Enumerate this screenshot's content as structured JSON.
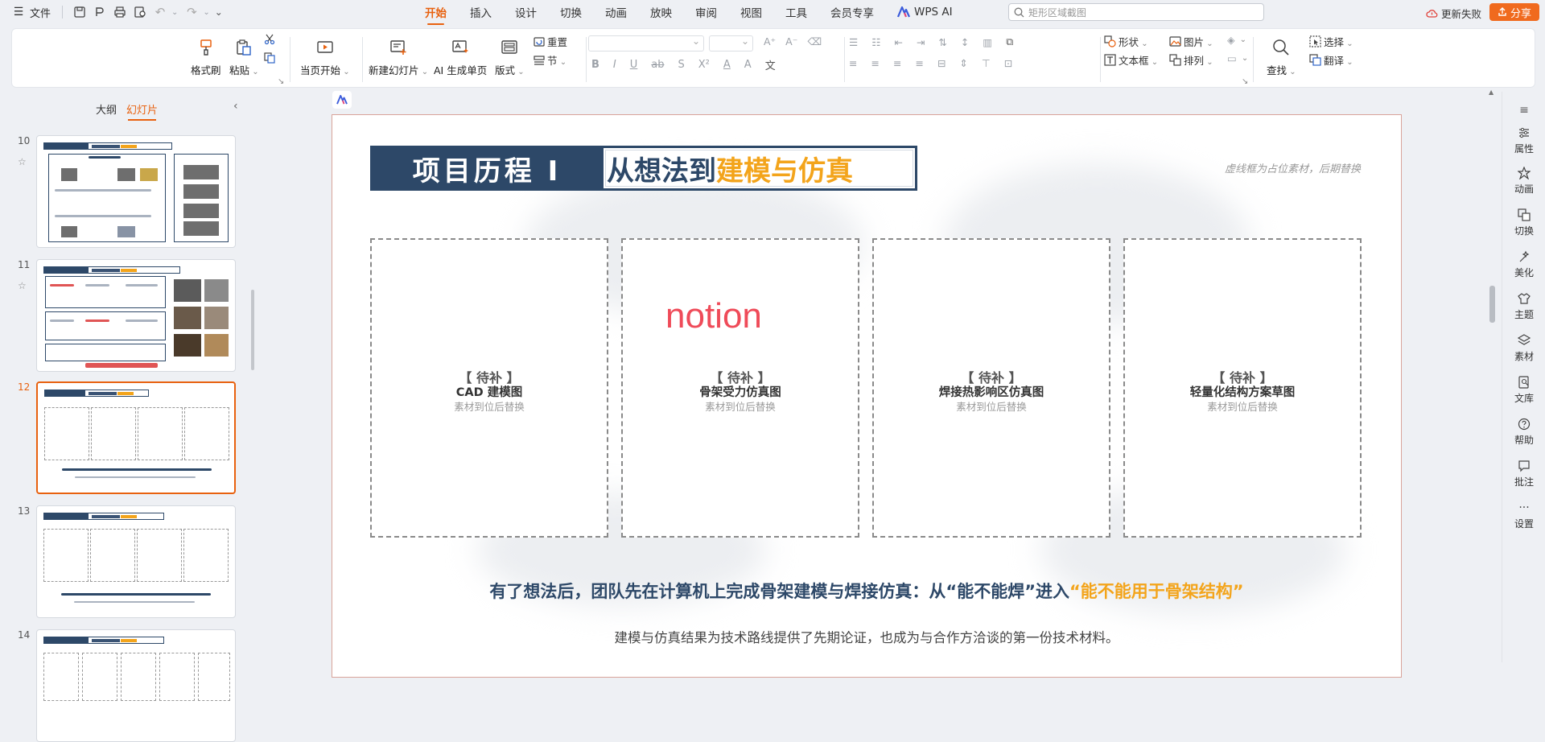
{
  "app": {
    "file_menu": "文件"
  },
  "tabs": [
    "开始",
    "插入",
    "设计",
    "切换",
    "动画",
    "放映",
    "审阅",
    "视图",
    "工具",
    "会员专享"
  ],
  "wps_ai": "WPS AI",
  "search": {
    "placeholder": "矩形区域截图"
  },
  "update_failed": "更新失败",
  "share": "分享",
  "ribbon": {
    "format_painter": "格式刷",
    "paste": "粘贴",
    "from_current": "当页开始",
    "new_slide": "新建幻灯片",
    "ai_generate": "AI 生成单页",
    "layout": "版式",
    "reset": "重置",
    "section": "节",
    "shape": "形状",
    "picture": "图片",
    "textbox": "文本框",
    "arrange": "排列",
    "find": "查找",
    "select": "选择",
    "translate": "翻译",
    "font_btns": [
      "B",
      "I",
      "U",
      "ab",
      "S",
      "X²",
      "A",
      "A",
      "文"
    ]
  },
  "left_pane": {
    "tab_outline": "大纲",
    "tab_slides": "幻灯片",
    "thumbnails": [
      {
        "num": "10",
        "starred": true,
        "active": false
      },
      {
        "num": "11",
        "starred": true,
        "active": false
      },
      {
        "num": "12",
        "starred": false,
        "active": true
      },
      {
        "num": "13",
        "starred": false,
        "active": false
      },
      {
        "num": "14",
        "starred": false,
        "active": false
      }
    ]
  },
  "slide": {
    "title_left": "项目历程 I",
    "title_right_plain": "从想法到",
    "title_right_highlight": "建模与仿真",
    "placeholder_note": "虚线框为占位素材，后期替换",
    "cards": [
      {
        "status": "【 待补 】",
        "title": "CAD 建模图",
        "note": "素材到位后替换"
      },
      {
        "status": "【 待补 】",
        "title": "骨架受力仿真图",
        "note": "素材到位后替换"
      },
      {
        "status": "【 待补 】",
        "title": "焊接热影响区仿真图",
        "note": "素材到位后替换"
      },
      {
        "status": "【 待补 】",
        "title": "轻量化结构方案草图",
        "note": "素材到位后替换"
      }
    ],
    "overlay_text": "notion",
    "caption_main": "有了想法后，团队先在计算机上完成骨架建模与焊接仿真：从“能不能焊”进入",
    "caption_highlight": "“能不能用于骨架结构”",
    "caption_sub": "建模与仿真结果为技术路线提供了先期论证，也成为与合作方洽谈的第一份技术材料。"
  },
  "right_panel": [
    "属性",
    "动画",
    "切换",
    "美化",
    "主题",
    "素材",
    "文库",
    "帮助",
    "批注",
    "设置"
  ],
  "colors": {
    "accent": "#e8610f",
    "navy": "#2d4868",
    "gold": "#f3a41b",
    "share_bg": "#f06a1e",
    "notion_red": "#ef4b59"
  }
}
